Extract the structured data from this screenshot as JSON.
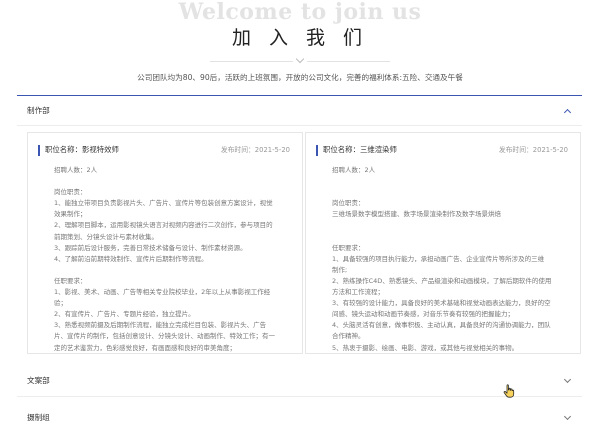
{
  "hero": {
    "title_en": "Welcome to join us",
    "title_cn": "加 入 我 们",
    "subtitle": "公司团队均为80、90后，活跃的上班氛围，开放的公司文化，完善的福利体系:五险、交通及午餐"
  },
  "sections": [
    {
      "title": "制作部",
      "expanded": true
    },
    {
      "title": "文案部",
      "expanded": false
    },
    {
      "title": "摄制组",
      "expanded": false
    }
  ],
  "jobs": [
    {
      "title": "职位名称：影视特效师",
      "date": "发布时间：2021-5-20",
      "lines": [
        "招聘人数：2人",
        "",
        "岗位职责：",
        "1、能独立带项目负责影视片头、广告片、宣传片等包装创意方案设计，视觉",
        "效果制作；",
        "2、理解项目脚本，运用影视镜头语言对视频内容进行二次创作，参与项目的",
        "前期策划、分镜头设计与素材收集。",
        "3、跟踪前后设计服务，完善日常技术储备与设计、制作素材资源。",
        "4、了解前沿前期特效制作、宣传片后期制作等流程。",
        "",
        "任职要求：",
        "1、影视、美术、动画、广告等相关专业院校毕业，2年以上从事影视工作经",
        "验；",
        "2、有宣传片、广告片、专题片经验，独立提片。",
        "3、熟悉视频前摄及后期制作流程，能独立完成栏目包装、影视片头、广告",
        "片、宣传片的制作，包括创意设计、分镜头设计、动画制作、特效工作；有一",
        "定的艺术鉴赏力，色彩感觉良好，有画面感和良好的审美角度；"
      ]
    },
    {
      "title": "职位名称：三维渲染师",
      "date": "发布时间：2021-5-20",
      "lines": [
        "招聘人数：2人",
        "",
        "",
        "岗位职责：",
        "三维场景数字模型搭建、数字场景渲染制作及数字场景烘焙",
        "",
        "",
        "任职要求：",
        "1、具备较强的项目执行能力，承担动画广告、企业宣传片等所涉及的三维",
        "制作;",
        "2、熟练操作C4D、熟悉镜头、产品级渲染和动画模块，了解后期软件的使用",
        "方法和工作流程；",
        "3、有较强的设计能力，具备良好的美术基础和视觉动画表达能力，良好的空",
        "间感、镜头运动和动画节奏感，对音乐节奏有较强的把握能力；",
        "4、头脑灵活有创意，做事积极、主动认真，具备良好的沟通协调能力，团队",
        "合作精神。",
        "5、热衷于摄影、绘画、电影、游戏，或其他与视觉相关的事物。"
      ]
    }
  ]
}
